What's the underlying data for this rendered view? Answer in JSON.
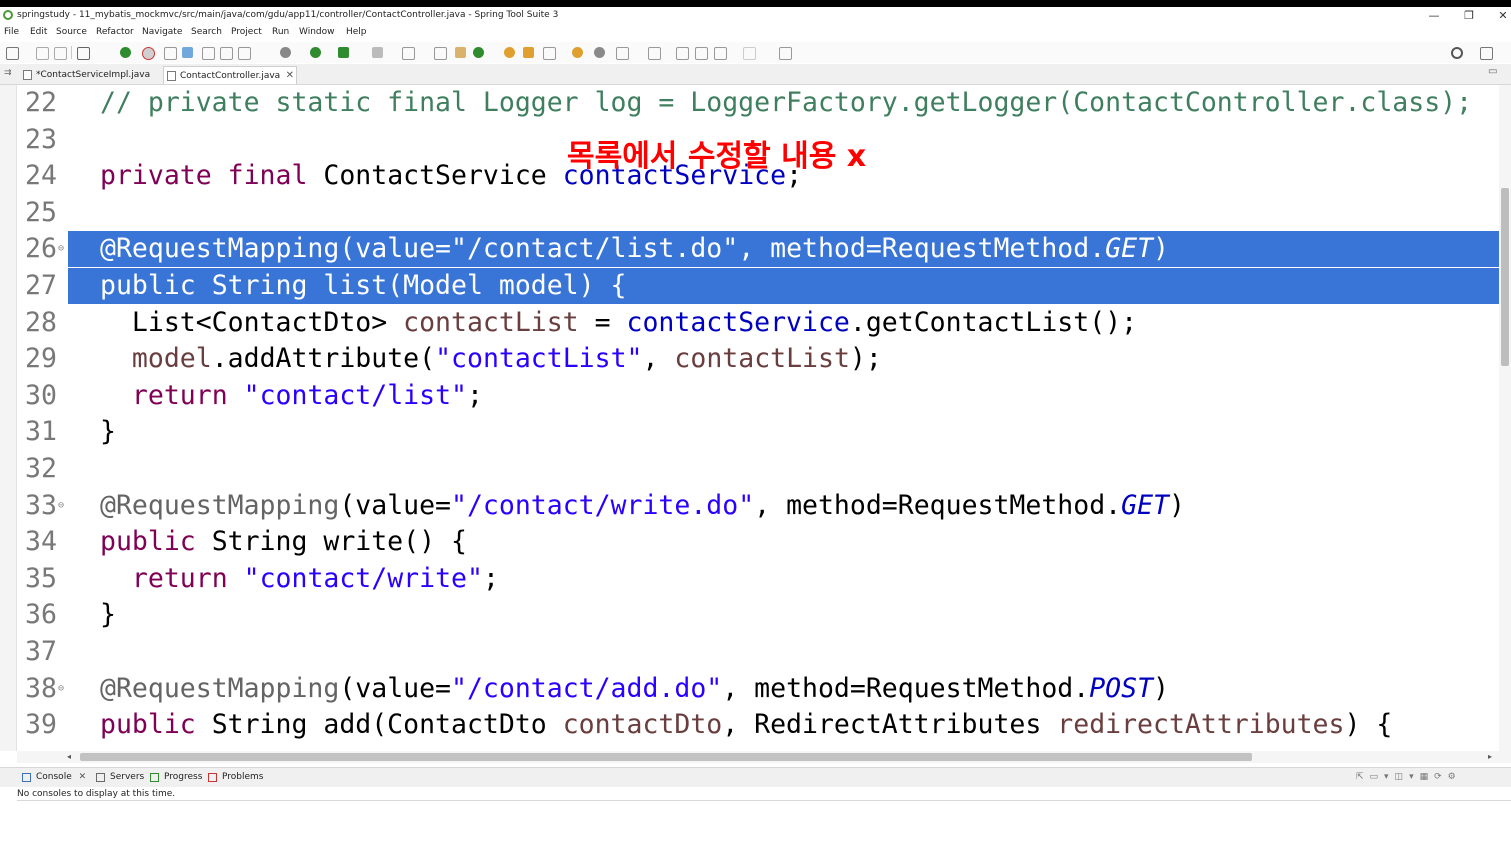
{
  "window": {
    "title": "springstudy - 11_mybatis_mockmvc/src/main/java/com/gdu/app11/controller/ContactController.java - Spring Tool Suite 3",
    "minimize": "—",
    "restore": "❐",
    "close": "✕"
  },
  "menu": [
    "File",
    "Edit",
    "Source",
    "Refactor",
    "Navigate",
    "Search",
    "Project",
    "Run",
    "Window",
    "Help"
  ],
  "tabs": [
    {
      "label": "*ContactServiceImpl.java",
      "active": false
    },
    {
      "label": "ContactController.java",
      "active": true,
      "close": "✕"
    }
  ],
  "overlay_text": "목록에서 수정할 내용 x",
  "code_lines": [
    {
      "num": "22",
      "tokens": [
        {
          "t": "// private static final Logger log = LoggerFactory.getLogger(ContactController.class);",
          "c": "cmt"
        }
      ]
    },
    {
      "num": "23",
      "tokens": []
    },
    {
      "num": "24",
      "tokens": [
        {
          "t": "private final",
          "c": "kw"
        },
        {
          "t": " ContactService ",
          "c": ""
        },
        {
          "t": "contactService",
          "c": "fld"
        },
        {
          "t": ";",
          "c": ""
        }
      ]
    },
    {
      "num": "25",
      "tokens": []
    },
    {
      "num": "26",
      "fold": "⊖",
      "sel": true,
      "tokens": [
        {
          "t": "@RequestMapping",
          "c": "ann"
        },
        {
          "t": "(value=",
          "c": ""
        },
        {
          "t": "\"/contact/list.do\"",
          "c": "str"
        },
        {
          "t": ", method=RequestMethod.",
          "c": ""
        },
        {
          "t": "GET",
          "c": "ital"
        },
        {
          "t": ")",
          "c": ""
        }
      ]
    },
    {
      "num": "27",
      "sel": true,
      "tokens": [
        {
          "t": "public",
          "c": "kw"
        },
        {
          "t": " String list(Model model) {",
          "c": ""
        }
      ]
    },
    {
      "num": "28",
      "tokens": [
        {
          "t": "  List<ContactDto> ",
          "c": ""
        },
        {
          "t": "contactList",
          "c": "var"
        },
        {
          "t": " = ",
          "c": ""
        },
        {
          "t": "contactService",
          "c": "fld"
        },
        {
          "t": ".getContactList();",
          "c": ""
        }
      ]
    },
    {
      "num": "29",
      "tokens": [
        {
          "t": "  ",
          "c": ""
        },
        {
          "t": "model",
          "c": "var"
        },
        {
          "t": ".addAttribute(",
          "c": ""
        },
        {
          "t": "\"contactList\"",
          "c": "str"
        },
        {
          "t": ", ",
          "c": ""
        },
        {
          "t": "contactList",
          "c": "var"
        },
        {
          "t": ");",
          "c": ""
        }
      ]
    },
    {
      "num": "30",
      "tokens": [
        {
          "t": "  ",
          "c": ""
        },
        {
          "t": "return",
          "c": "kw"
        },
        {
          "t": " ",
          "c": ""
        },
        {
          "t": "\"contact/list\"",
          "c": "str"
        },
        {
          "t": ";",
          "c": ""
        }
      ]
    },
    {
      "num": "31",
      "tokens": [
        {
          "t": "}",
          "c": ""
        }
      ]
    },
    {
      "num": "32",
      "tokens": []
    },
    {
      "num": "33",
      "fold": "⊖",
      "tokens": [
        {
          "t": "@RequestMapping",
          "c": "ann"
        },
        {
          "t": "(value=",
          "c": ""
        },
        {
          "t": "\"/contact/write.do\"",
          "c": "str"
        },
        {
          "t": ", method=RequestMethod.",
          "c": ""
        },
        {
          "t": "GET",
          "c": "ital"
        },
        {
          "t": ")",
          "c": ""
        }
      ]
    },
    {
      "num": "34",
      "tokens": [
        {
          "t": "public",
          "c": "kw"
        },
        {
          "t": " String write() {",
          "c": ""
        }
      ]
    },
    {
      "num": "35",
      "tokens": [
        {
          "t": "  ",
          "c": ""
        },
        {
          "t": "return",
          "c": "kw"
        },
        {
          "t": " ",
          "c": ""
        },
        {
          "t": "\"contact/write\"",
          "c": "str"
        },
        {
          "t": ";",
          "c": ""
        }
      ]
    },
    {
      "num": "36",
      "tokens": [
        {
          "t": "}",
          "c": ""
        }
      ]
    },
    {
      "num": "37",
      "tokens": []
    },
    {
      "num": "38",
      "fold": "⊖",
      "tokens": [
        {
          "t": "@RequestMapping",
          "c": "ann"
        },
        {
          "t": "(value=",
          "c": ""
        },
        {
          "t": "\"/contact/add.do\"",
          "c": "str"
        },
        {
          "t": ", method=RequestMethod.",
          "c": ""
        },
        {
          "t": "POST",
          "c": "ital"
        },
        {
          "t": ")",
          "c": ""
        }
      ]
    },
    {
      "num": "39",
      "tokens": [
        {
          "t": "public",
          "c": "kw"
        },
        {
          "t": " String add(ContactDto ",
          "c": ""
        },
        {
          "t": "contactDto",
          "c": "var"
        },
        {
          "t": ", RedirectAttributes ",
          "c": ""
        },
        {
          "t": "redirectAttributes",
          "c": "var"
        },
        {
          "t": ") {",
          "c": ""
        }
      ]
    }
  ],
  "bottom_tabs": [
    "Console",
    "Servers",
    "Progress",
    "Problems"
  ],
  "bottom_tab_close": "✕",
  "console_message": "No consoles to display at this time.",
  "colors": {
    "selection": "#3875d7",
    "keyword": "#7f0055",
    "string": "#2a00ff",
    "comment": "#3f7f5f",
    "field": "#0000c0",
    "overlay": "#ff0000"
  },
  "icons": {
    "search": "search-icon",
    "perspective": "perspective-icon"
  }
}
